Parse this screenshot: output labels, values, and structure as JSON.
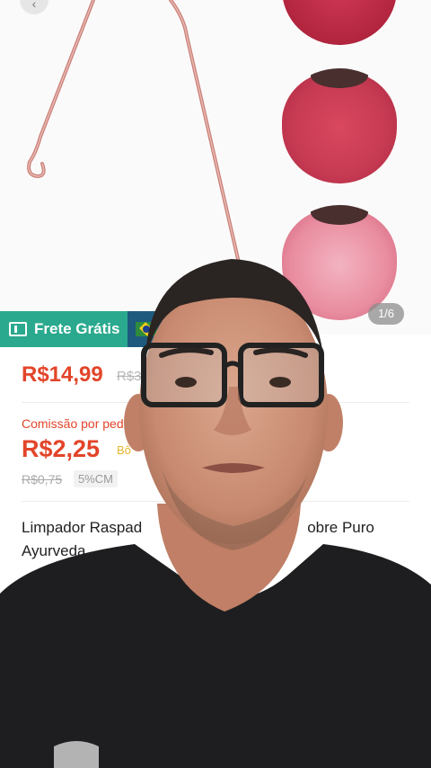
{
  "product": {
    "image_counter": "1/6",
    "image_subject": "copper tongue scraper and tongue samples"
  },
  "shipping_banner": {
    "label": "Frete Grátis",
    "icon": "truck-icon",
    "flag": "brazil-flag-icon"
  },
  "pricing": {
    "price": "R$14,99",
    "original_price": "R$3",
    "commission_label": "Comissão por ped",
    "commission_value": "R$2,25",
    "bonus_label": "Bô",
    "old_commission": "R$0,75",
    "commission_rate_badge": "5%CM"
  },
  "title": {
    "left": "Limpador Raspad",
    "right": "obre Puro",
    "line2": "Ayurveda"
  },
  "colors": {
    "accent": "#e2452a",
    "banner": "#2aa98e",
    "bonus": "#e8b52c"
  }
}
